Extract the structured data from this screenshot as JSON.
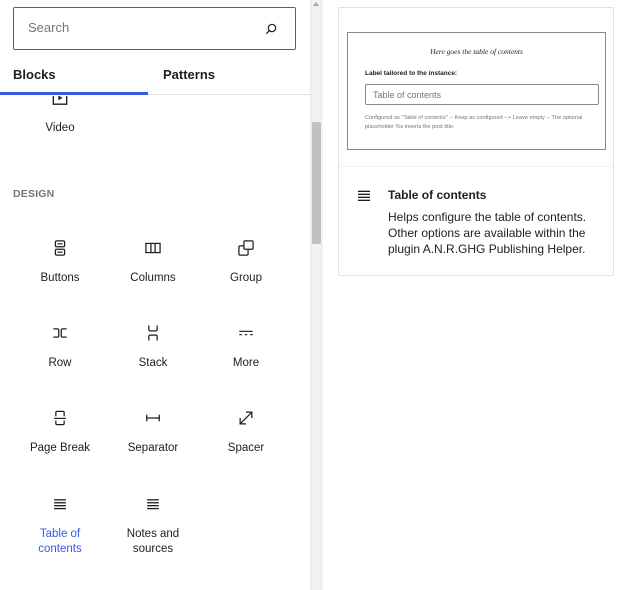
{
  "search": {
    "placeholder": "Search"
  },
  "tabs": [
    {
      "label": "Blocks",
      "selected": true
    },
    {
      "label": "Patterns",
      "selected": false
    }
  ],
  "partial_block": {
    "label": "Video",
    "icon": "video-icon"
  },
  "categories": {
    "design": "DESIGN"
  },
  "design_blocks": [
    {
      "label": "Buttons",
      "icon": "buttons-icon"
    },
    {
      "label": "Columns",
      "icon": "columns-icon"
    },
    {
      "label": "Group",
      "icon": "group-icon"
    },
    {
      "label": "Row",
      "icon": "row-icon"
    },
    {
      "label": "Stack",
      "icon": "stack-icon"
    },
    {
      "label": "More",
      "icon": "more-icon"
    },
    {
      "label": "Page Break",
      "icon": "page-break-icon"
    },
    {
      "label": "Separator",
      "icon": "separator-icon"
    },
    {
      "label": "Spacer",
      "icon": "spacer-icon"
    },
    {
      "label": "Table of contents",
      "label_line1": "Table of",
      "label_line2": "contents",
      "icon": "list-icon",
      "active": true
    },
    {
      "label": "Notes and sources",
      "label_line1": "Notes and",
      "label_line2": "sources",
      "icon": "list-icon"
    }
  ],
  "preview": {
    "thumbnail_title": "Here goes the table of contents",
    "thumbnail_label": "Label tailored to the instance:",
    "thumbnail_input_value": "Table of contents",
    "thumbnail_help": "Configured as \"Table of contents\" -- Keep as configured --> Leave empty -- The optional placeholder %s inserts the post title.",
    "block_title": "Table of contents",
    "block_description": "Helps configure the table of contents. Other options are available within the plugin A.N.R.GHG Publishing Helper."
  },
  "colors": {
    "accent": "#3858e9",
    "text": "#1e1e1e",
    "muted": "#757575"
  }
}
